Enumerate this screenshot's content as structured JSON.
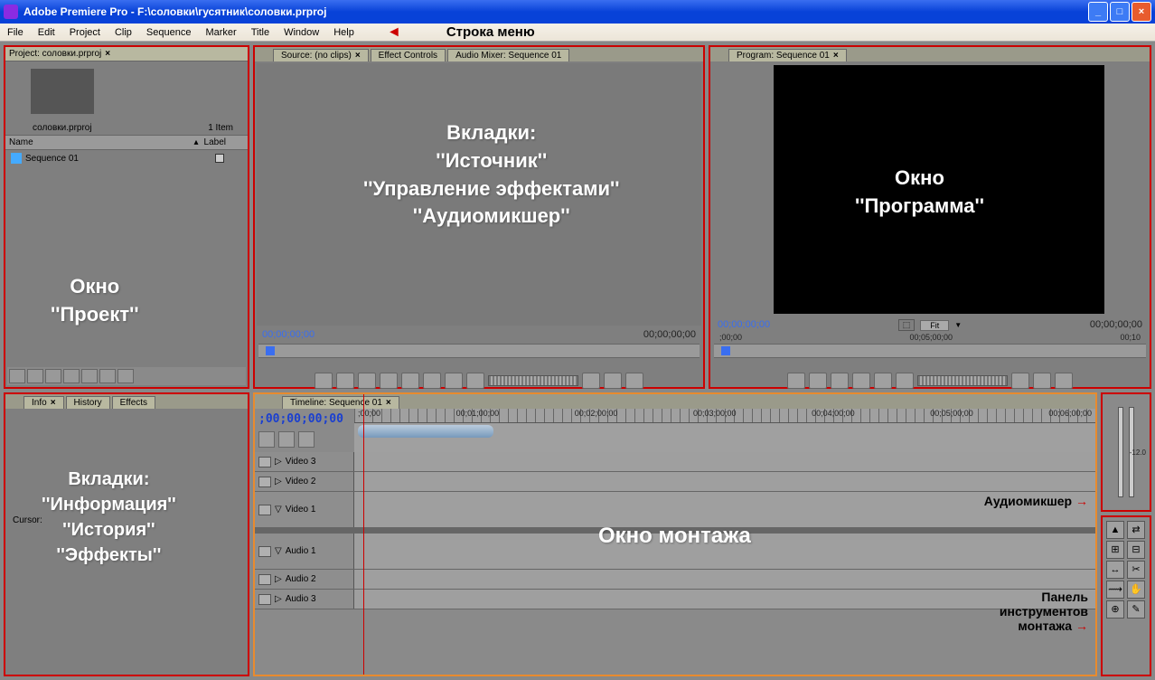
{
  "titlebar": {
    "app": "Adobe Premiere Pro",
    "path": "F:\\соловки\\гусятник\\соловки.prproj"
  },
  "menu": {
    "items": [
      "File",
      "Edit",
      "Project",
      "Clip",
      "Sequence",
      "Marker",
      "Title",
      "Window",
      "Help"
    ],
    "annotation": "Строка меню"
  },
  "project": {
    "tab": "Project: соловки.prproj",
    "filename": "соловки.prproj",
    "itemcount": "1 Item",
    "col_name": "Name",
    "col_label": "Label",
    "seq": "Sequence 01",
    "overlay_l1": "Окно",
    "overlay_l2": "''Проект''"
  },
  "source": {
    "tabs": [
      "Source: (no clips)",
      "Effect Controls",
      "Audio Mixer: Sequence 01"
    ],
    "tc_left": "00;00;00;00",
    "tc_right": "00;00;00;00",
    "overlay": "Вкладки:\n''Источник''\n''Управление эффектами''\n''Аудиомикшер''"
  },
  "program": {
    "tab": "Program: Sequence 01",
    "tc_left": "00;00;00;00",
    "tc_right": "00;00;00;00",
    "fit": "Fit",
    "ruler_marks": [
      ";00;00",
      "00;05;00;00",
      "00;10"
    ],
    "overlay_l1": "Окно",
    "overlay_l2": "''Программа''"
  },
  "info": {
    "tabs": [
      "Info",
      "History",
      "Effects"
    ],
    "cursor": "Cursor:",
    "overlay": "Вкладки:\n''Информация''\n''История''\n''Эффекты''"
  },
  "timeline": {
    "tab": "Timeline: Sequence 01",
    "tc": ";00;00;00;00",
    "ruler": [
      ";00;00",
      "00;01;00;00",
      "00;02;00;00",
      "00;03;00;00",
      "00;04;00;00",
      "00;05;00;00",
      "00;06;00;00"
    ],
    "video_tracks": [
      "Video 3",
      "Video 2",
      "Video 1"
    ],
    "audio_tracks": [
      "Audio 1",
      "Audio 2",
      "Audio 3"
    ],
    "overlay": "Окно монтажа",
    "label_mixer": "Аудиомикшер",
    "label_tools": "Панель\nинструментов\nмонтажа"
  },
  "mixer_db": "-12.0",
  "tools_icons": [
    "▲",
    "⇄",
    "⊞",
    "⊟",
    "↔",
    "✂",
    "⟿",
    "✋",
    "⊕",
    "✎"
  ]
}
